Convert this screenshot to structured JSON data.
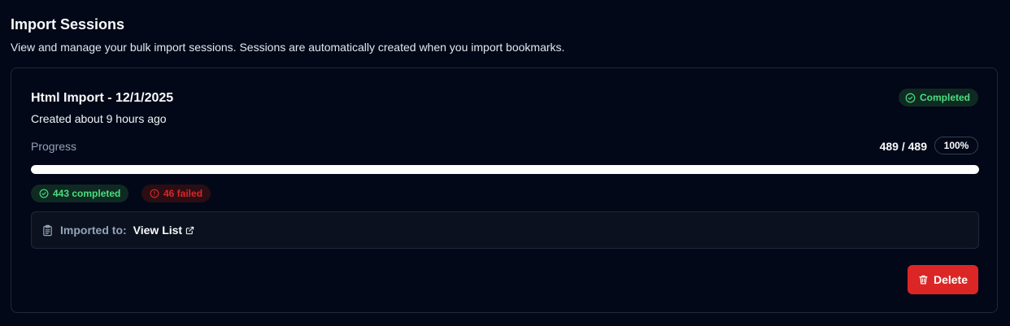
{
  "section": {
    "title": "Import Sessions",
    "description": "View and manage your bulk import sessions. Sessions are automatically created when you import bookmarks."
  },
  "session": {
    "title": "Html Import - 12/1/2025",
    "created": "Created about 9 hours ago",
    "status_label": "Completed",
    "progress_label": "Progress",
    "progress_count": "489 / 489",
    "progress_percent": "100%",
    "progress_fraction": 1.0,
    "completed_label": "443 completed",
    "failed_label": "46 failed",
    "imported_to_label": "Imported to:",
    "view_list_label": "View List",
    "delete_label": "Delete"
  },
  "icons": {
    "status": "check-circle-icon",
    "completed": "check-circle-icon",
    "failed": "alert-circle-icon",
    "imported": "clipboard-icon",
    "external": "external-link-icon",
    "delete": "trash-icon"
  },
  "colors": {
    "background": "#020817",
    "success": "#4ade80",
    "danger": "#dc2626",
    "progress": "#ffffff"
  }
}
